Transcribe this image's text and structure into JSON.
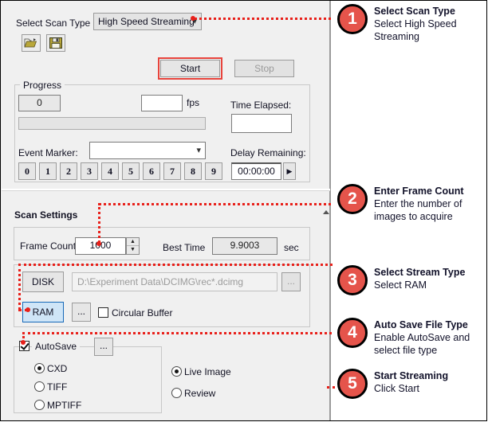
{
  "app": {
    "scan_type_label": "Select Scan Type",
    "scan_type_value": "High Speed Streaming",
    "open_icon": "open-folder-icon",
    "save_icon": "floppy-save-icon",
    "start_label": "Start",
    "stop_label": "Stop"
  },
  "progress": {
    "group_title": "Progress",
    "frame_count_value": "0",
    "fps_value": "",
    "fps_label": "fps",
    "time_elapsed_label": "Time Elapsed:",
    "time_elapsed_value": "",
    "event_marker_label": "Event Marker:",
    "event_marker_value": "",
    "marker_buttons": [
      "0",
      "1",
      "2",
      "3",
      "4",
      "5",
      "6",
      "7",
      "8",
      "9"
    ],
    "delay_remaining_label": "Delay Remaining:",
    "delay_remaining_value": "00:00:00",
    "delay_play_icon": "play-arrow-icon"
  },
  "scan_settings": {
    "title": "Scan Settings",
    "frame_count_label": "Frame Count",
    "frame_count_value": "1000",
    "best_time_label": "Best Time",
    "best_time_value": "9.9003",
    "best_time_unit": "sec",
    "disk_label": "DISK",
    "disk_path_placeholder": "D:\\Experiment Data\\DCIMG\\rec*.dcimg",
    "disk_browse_label": "...",
    "ram_label": "RAM",
    "ram_browse_label": "...",
    "circular_buffer_label": "Circular Buffer",
    "circular_buffer_checked": false,
    "selected_stream": "RAM"
  },
  "autosave": {
    "label": "AutoSave",
    "checked": true,
    "browse_label": "...",
    "file_types": [
      {
        "label": "CXD",
        "selected": true
      },
      {
        "label": "TIFF",
        "selected": false
      },
      {
        "label": "MPTIFF",
        "selected": false
      }
    ],
    "view_modes": [
      {
        "label": "Live Image",
        "selected": true
      },
      {
        "label": "Review",
        "selected": false
      }
    ]
  },
  "annotations": [
    {
      "number": "1",
      "title": "Select Scan Type",
      "body_line1": "Select High Speed",
      "body_line2": "Streaming"
    },
    {
      "number": "2",
      "title": "Enter Frame Count",
      "body_line1": "Enter the number of",
      "body_line2": "images to acquire"
    },
    {
      "number": "3",
      "title": "Select Stream Type",
      "body_line1": "Select RAM",
      "body_line2": ""
    },
    {
      "number": "4",
      "title": "Auto Save File Type",
      "body_line1": "Enable AutoSave and",
      "body_line2": "select file type"
    },
    {
      "number": "5",
      "title": "Start Streaming",
      "body_line1": "Click Start",
      "body_line2": ""
    }
  ],
  "colors": {
    "callout_red": "#e5544b",
    "leader_red": "#e8201a",
    "highlight_red": "#e8443c",
    "select_blue": "#1668b8"
  }
}
